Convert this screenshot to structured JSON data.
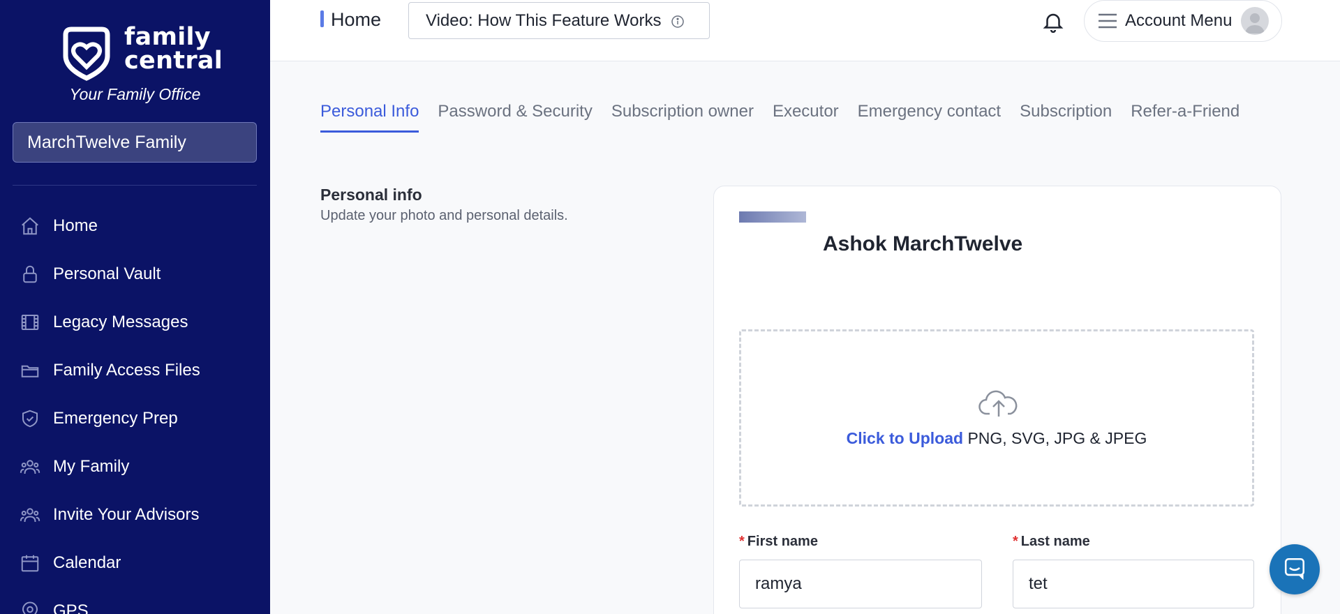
{
  "brand": {
    "name_line1": "family",
    "name_line2": "central",
    "tagline": "Your Family Office"
  },
  "family_selector": {
    "value": "MarchTwelve Family"
  },
  "sidebar": {
    "items": [
      {
        "label": "Home",
        "icon": "home-icon"
      },
      {
        "label": "Personal Vault",
        "icon": "lock-icon"
      },
      {
        "label": "Legacy Messages",
        "icon": "film-icon"
      },
      {
        "label": "Family Access Files",
        "icon": "folder-icon"
      },
      {
        "label": "Emergency Prep",
        "icon": "shield-check-icon"
      },
      {
        "label": "My Family",
        "icon": "people-icon"
      },
      {
        "label": "Invite Your Advisors",
        "icon": "people-icon"
      },
      {
        "label": "Calendar",
        "icon": "calendar-icon"
      },
      {
        "label": "GPS",
        "icon": "map-pin-icon"
      }
    ]
  },
  "header": {
    "breadcrumb": "Home",
    "video_button": "Video: How This Feature Works",
    "account_menu": "Account Menu"
  },
  "tabs": [
    {
      "label": "Personal Info",
      "active": true
    },
    {
      "label": "Password & Security",
      "active": false
    },
    {
      "label": "Subscription owner",
      "active": false
    },
    {
      "label": "Executor",
      "active": false
    },
    {
      "label": "Emergency contact",
      "active": false
    },
    {
      "label": "Subscription",
      "active": false
    },
    {
      "label": "Refer-a-Friend",
      "active": false
    }
  ],
  "section": {
    "title": "Personal info",
    "subtitle": "Update your photo and personal details."
  },
  "profile": {
    "name": "Ashok MarchTwelve"
  },
  "upload": {
    "link": "Click to Upload",
    "formats": "PNG, SVG, JPG & JPEG"
  },
  "form": {
    "first_name_label": "First name",
    "first_name_value": "ramya",
    "last_name_label": "Last name",
    "last_name_value": "tet",
    "required_mark": "*"
  },
  "colors": {
    "sidebar": "#0b1366",
    "accent": "#3b5bdb",
    "chat": "#1a73b8"
  }
}
